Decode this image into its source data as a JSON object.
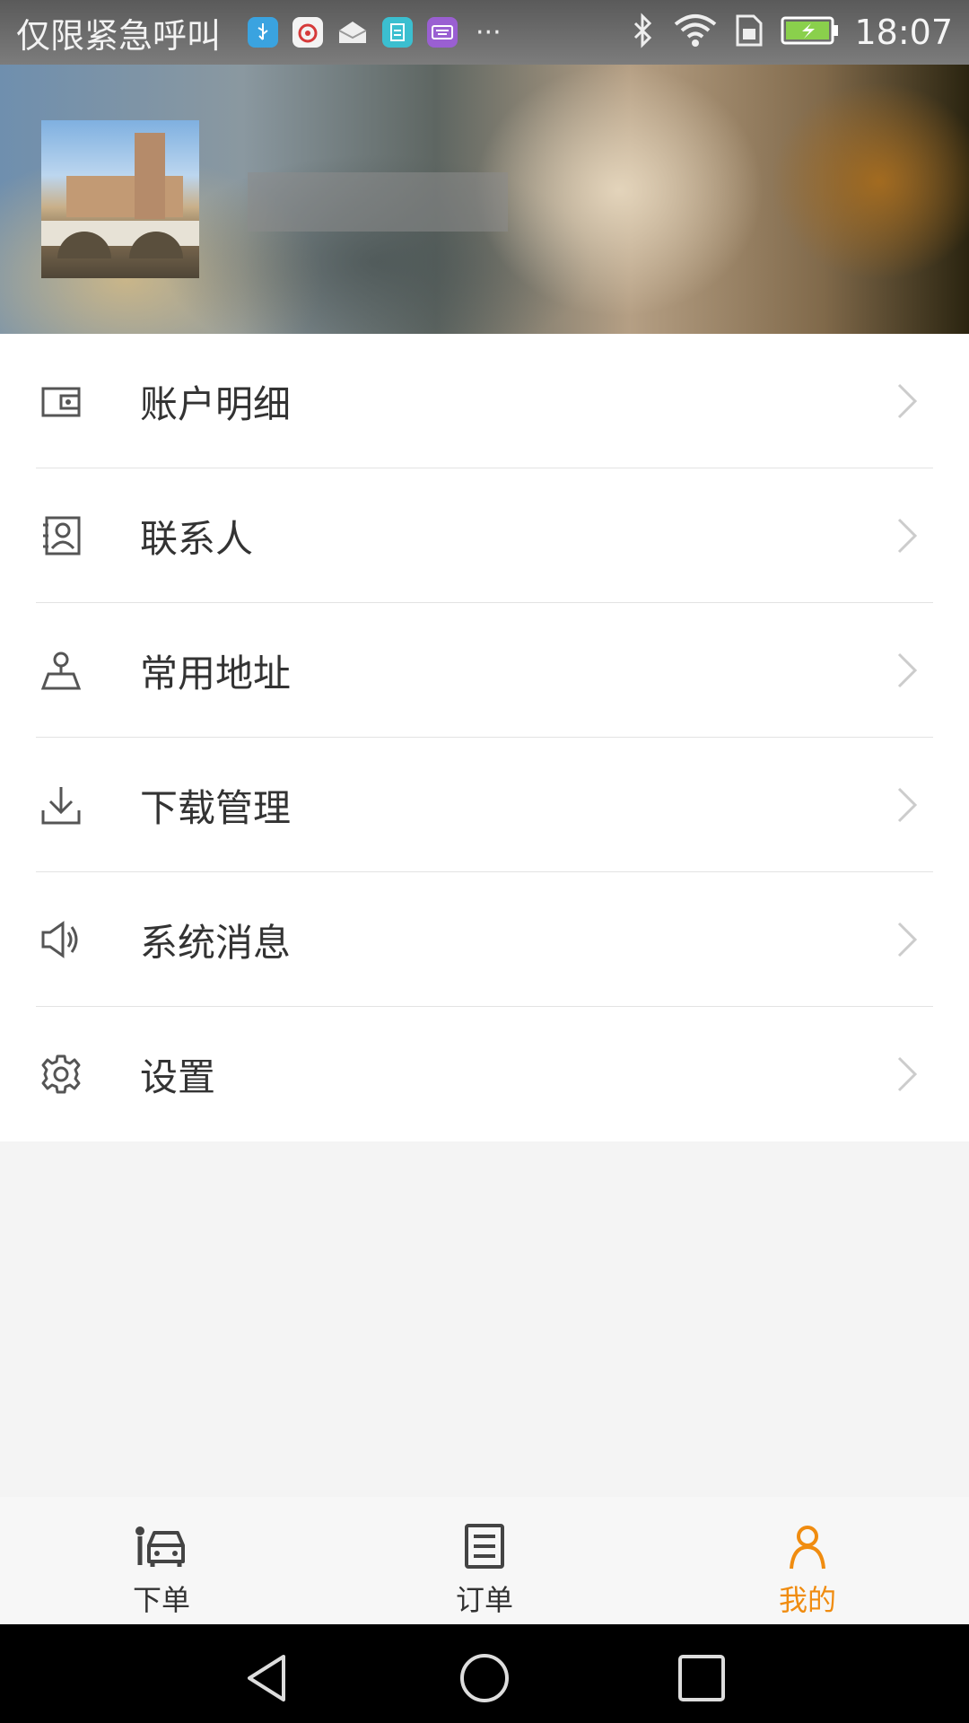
{
  "status_bar": {
    "carrier_text": "仅限紧急呼叫",
    "time": "18:07",
    "app_icons": [
      "usb-icon",
      "weibo-icon",
      "mail-icon",
      "calendar-app-icon",
      "keyboard-app-icon"
    ],
    "more": "···",
    "right_icons": [
      "bluetooth-icon",
      "wifi-icon",
      "sim-icon",
      "battery-charging-icon"
    ]
  },
  "menu": {
    "items": [
      {
        "label": "账户明细",
        "icon": "wallet-icon"
      },
      {
        "label": "联系人",
        "icon": "contacts-icon"
      },
      {
        "label": "常用地址",
        "icon": "location-map-icon"
      },
      {
        "label": "下载管理",
        "icon": "download-icon"
      },
      {
        "label": "系统消息",
        "icon": "speaker-icon"
      },
      {
        "label": "设置",
        "icon": "gear-icon"
      }
    ]
  },
  "tabs": [
    {
      "label": "下单",
      "icon": "car-person-icon",
      "active": false
    },
    {
      "label": "订单",
      "icon": "order-list-icon",
      "active": false
    },
    {
      "label": "我的",
      "icon": "person-icon",
      "active": true
    }
  ],
  "colors": {
    "accent": "#f08c10",
    "text": "#333333",
    "icon": "#555555",
    "chevron": "#cccccc",
    "background": "#f4f4f4"
  }
}
